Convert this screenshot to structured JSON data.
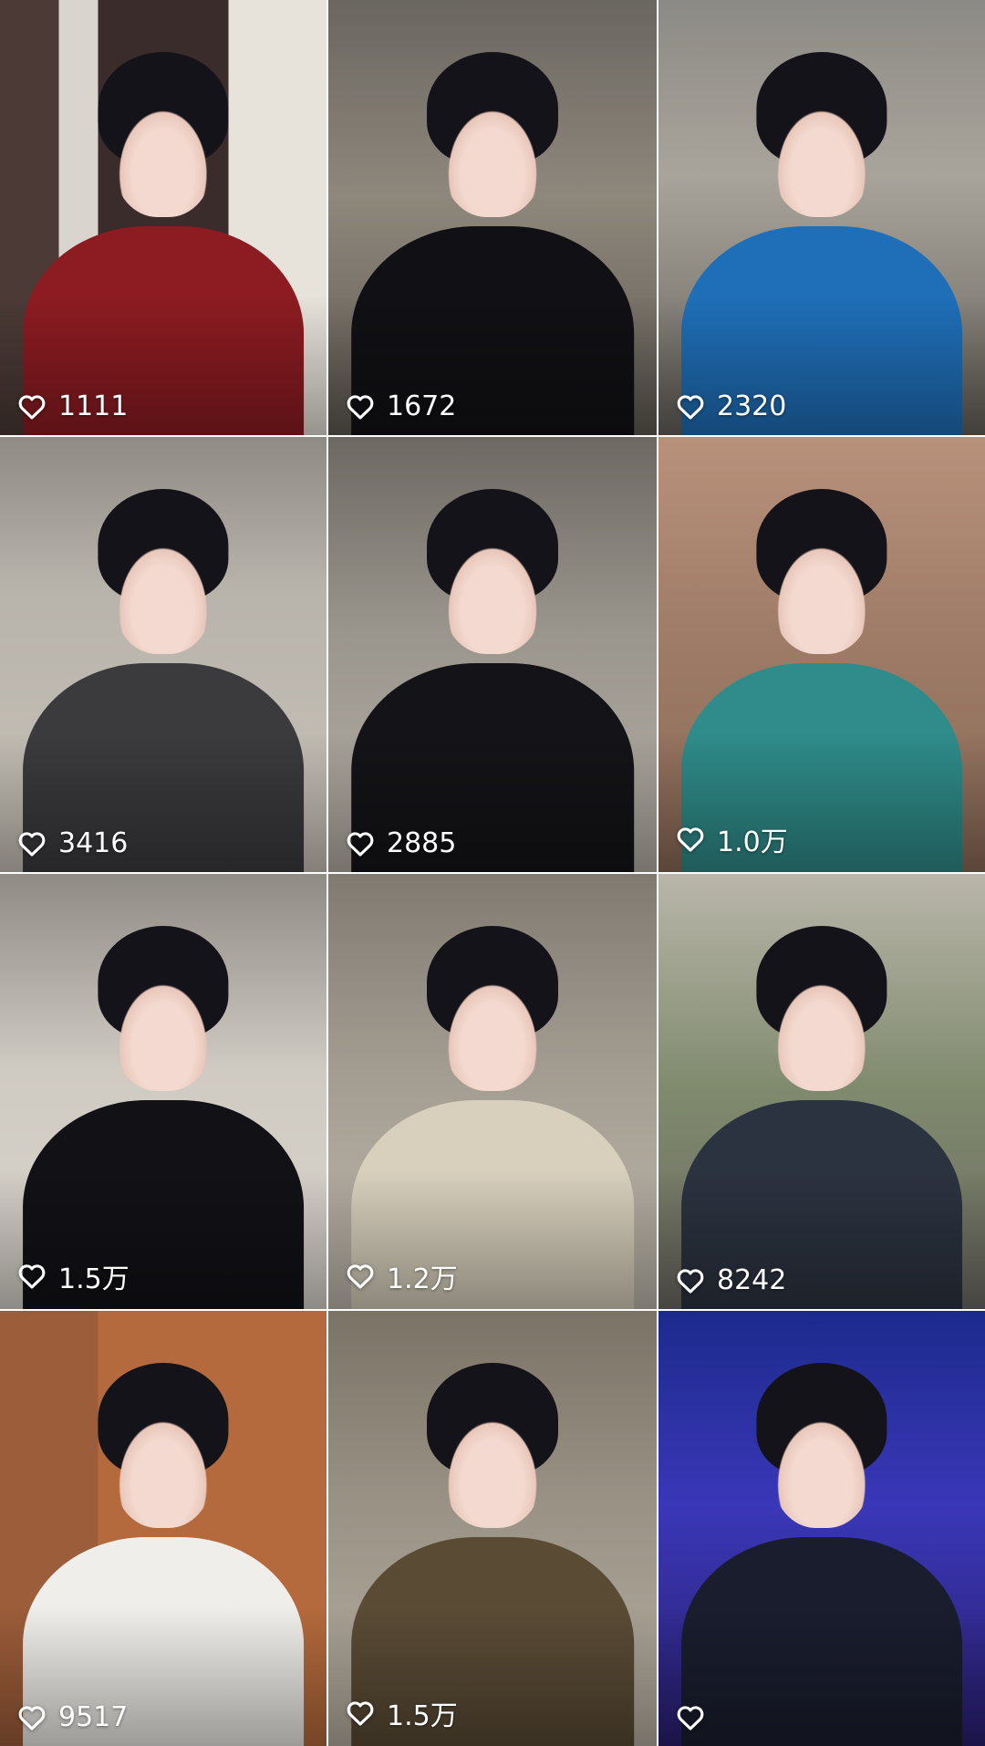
{
  "feed": {
    "tiles": [
      {
        "likes": "1111"
      },
      {
        "likes": "1672"
      },
      {
        "likes": "2320"
      },
      {
        "likes": "3416"
      },
      {
        "likes": "2885"
      },
      {
        "likes": "1.0万"
      },
      {
        "likes": "1.5万"
      },
      {
        "likes": "1.2万"
      },
      {
        "likes": "8242"
      },
      {
        "likes": "9517"
      },
      {
        "likes": "1.5万"
      },
      {
        "likes": ""
      }
    ]
  },
  "icons": {
    "like": "heart-outline-icon"
  },
  "colors": {
    "like_text": "#ffffff",
    "grid_gap": "#ffffff"
  }
}
